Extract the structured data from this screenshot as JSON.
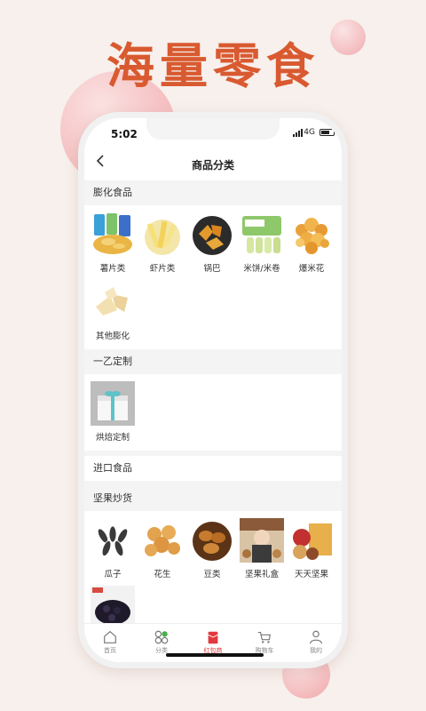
{
  "banner": {
    "title": "海量零食"
  },
  "status": {
    "time": "5:02",
    "network": "4G"
  },
  "nav": {
    "title": "商品分类"
  },
  "sections": {
    "puffed": {
      "title": "膨化食品",
      "items": [
        "薯片类",
        "虾片类",
        "锅巴",
        "米饼/米卷",
        "爆米花",
        "其他膨化"
      ]
    },
    "custom": {
      "title": "一乙定制",
      "items": [
        "烘焙定制"
      ]
    },
    "imported": {
      "title": "进口食品"
    },
    "nuts": {
      "title": "坚果炒货",
      "items": [
        "瓜子",
        "花生",
        "豆类",
        "坚果礼盒",
        "天天坚果"
      ]
    }
  },
  "tabs": {
    "home": "首页",
    "category": "分类",
    "hongbao": "红包商",
    "cart": "购物车",
    "mine": "我的"
  },
  "colors": {
    "accent": "#d95a30",
    "tab_active": "#e0393e"
  }
}
